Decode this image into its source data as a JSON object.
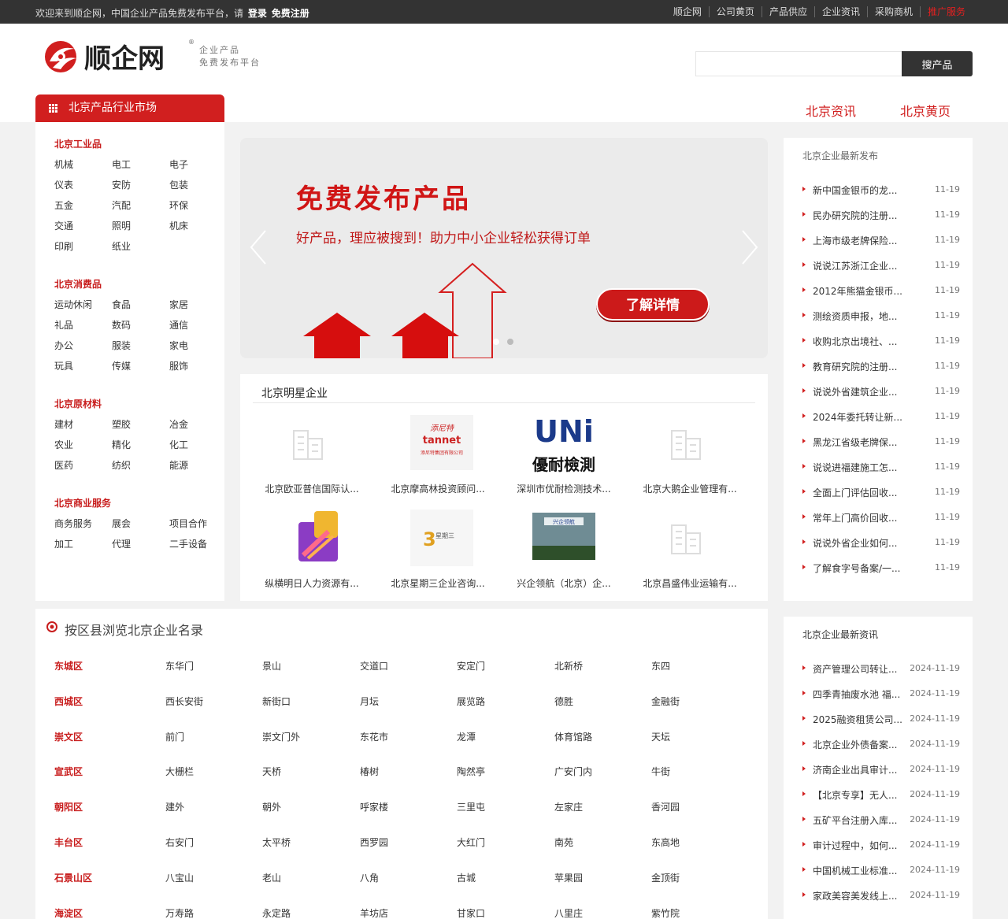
{
  "topbar": {
    "welcome": "欢迎来到顺企网，中国企业产品免费发布平台，请",
    "login": "登录",
    "register": "免费注册",
    "nav": [
      "顺企网",
      "公司黄页",
      "产品供应",
      "企业资讯",
      "采购商机",
      "推广服务"
    ]
  },
  "header": {
    "logo_text": "顺企网",
    "slogan_1": "企业产品",
    "slogan_2": "免费发布平台",
    "search_placeholder": "",
    "search_button": "搜产品"
  },
  "category": {
    "title": "北京产品行业市场",
    "tabs": [
      "北京资讯",
      "北京黄页"
    ],
    "groups": [
      {
        "title": "北京工业品",
        "items": [
          "机械",
          "电工",
          "电子",
          "仪表",
          "安防",
          "包装",
          "五金",
          "汽配",
          "环保",
          "交通",
          "照明",
          "机床",
          "印刷",
          "纸业"
        ]
      },
      {
        "title": "北京消费品",
        "items": [
          "运动休闲",
          "食品",
          "家居",
          "礼品",
          "数码",
          "通信",
          "办公",
          "服装",
          "家电",
          "玩具",
          "传媒",
          "服饰"
        ]
      },
      {
        "title": "北京原材料",
        "items": [
          "建材",
          "塑胶",
          "冶金",
          "农业",
          "精化",
          "化工",
          "医药",
          "纺织",
          "能源"
        ]
      },
      {
        "title": "北京商业服务",
        "items": [
          "商务服务",
          "展会",
          "项目合作",
          "加工",
          "代理",
          "二手设备"
        ]
      }
    ]
  },
  "banner": {
    "headline": "免费发布产品",
    "subline": "好产品，理应被搜到！助力中小企业轻松获得订单",
    "button": "了解详情"
  },
  "star": {
    "title": "北京明星企业",
    "companies": [
      {
        "name": "北京欧亚普信国际认...",
        "logo": "placeholder"
      },
      {
        "name": "北京摩高林投资顾问...",
        "logo": "tannet",
        "logo_text_1": "添尼特",
        "logo_text_2": "tannet",
        "logo_text_3": "添尼特集团有限公司"
      },
      {
        "name": "深圳市优耐检测技术...",
        "logo": "uni",
        "logo_text_1": "UNi",
        "logo_text_2": "優耐檢測"
      },
      {
        "name": "北京大鹅企业管理有...",
        "logo": "placeholder"
      },
      {
        "name": "纵横明日人力资源有...",
        "logo": "hr"
      },
      {
        "name": "北京星期三企业咨询...",
        "logo": "wed",
        "logo_text_1": "3",
        "logo_text_2": "星期三"
      },
      {
        "name": "兴企领航（北京）企...",
        "logo": "photo",
        "logo_text_1": "兴企领航"
      },
      {
        "name": "北京昌盛伟业运输有...",
        "logo": "placeholder"
      }
    ]
  },
  "latest": {
    "title": "北京企业最新发布",
    "items": [
      {
        "t": "新中国金银币的龙...",
        "d": "11-19"
      },
      {
        "t": "民办研究院的注册...",
        "d": "11-19"
      },
      {
        "t": "上海市级老牌保险...",
        "d": "11-19"
      },
      {
        "t": "说说江苏浙江企业...",
        "d": "11-19"
      },
      {
        "t": "2012年熊猫金银币...",
        "d": "11-19"
      },
      {
        "t": "测绘资质申报，地...",
        "d": "11-19"
      },
      {
        "t": "收购北京出境社、...",
        "d": "11-19"
      },
      {
        "t": "教育研究院的注册...",
        "d": "11-19"
      },
      {
        "t": "说说外省建筑企业...",
        "d": "11-19"
      },
      {
        "t": "2024年委托转让新...",
        "d": "11-19"
      },
      {
        "t": "黑龙江省级老牌保...",
        "d": "11-19"
      },
      {
        "t": "说说进福建施工怎...",
        "d": "11-19"
      },
      {
        "t": "全面上门评估回收...",
        "d": "11-19"
      },
      {
        "t": "常年上门高价回收...",
        "d": "11-19"
      },
      {
        "t": "说说外省企业如何...",
        "d": "11-19"
      },
      {
        "t": "了解食字号备案/一...",
        "d": "11-19"
      }
    ]
  },
  "news": {
    "title": "北京企业最新资讯",
    "items": [
      {
        "t": "资产管理公司转让...",
        "d": "2024-11-19"
      },
      {
        "t": "四季青抽废水池 福...",
        "d": "2024-11-19"
      },
      {
        "t": "2025融资租赁公司...",
        "d": "2024-11-19"
      },
      {
        "t": "北京企业外债备案...",
        "d": "2024-11-19"
      },
      {
        "t": "济南企业出具审计...",
        "d": "2024-11-19"
      },
      {
        "t": "【北京专享】无人...",
        "d": "2024-11-19"
      },
      {
        "t": "五矿平台注册入库...",
        "d": "2024-11-19"
      },
      {
        "t": "审计过程中，如何...",
        "d": "2024-11-19"
      },
      {
        "t": "中国机械工业标准...",
        "d": "2024-11-19"
      },
      {
        "t": "家政美容美发线上...",
        "d": "2024-11-19"
      }
    ]
  },
  "areas": {
    "title": "按区县浏览北京企业名录",
    "rows": [
      {
        "district": "东城区",
        "places": [
          "东华门",
          "景山",
          "交道口",
          "安定门",
          "北新桥",
          "东四"
        ]
      },
      {
        "district": "西城区",
        "places": [
          "西长安街",
          "新街口",
          "月坛",
          "展览路",
          "德胜",
          "金融街"
        ]
      },
      {
        "district": "崇文区",
        "places": [
          "前门",
          "崇文门外",
          "东花市",
          "龙潭",
          "体育馆路",
          "天坛"
        ]
      },
      {
        "district": "宣武区",
        "places": [
          "大栅栏",
          "天桥",
          "椿树",
          "陶然亭",
          "广安门内",
          "牛街"
        ]
      },
      {
        "district": "朝阳区",
        "places": [
          "建外",
          "朝外",
          "呼家楼",
          "三里屯",
          "左家庄",
          "香河园"
        ]
      },
      {
        "district": "丰台区",
        "places": [
          "右安门",
          "太平桥",
          "西罗园",
          "大红门",
          "南苑",
          "东高地"
        ]
      },
      {
        "district": "石景山区",
        "places": [
          "八宝山",
          "老山",
          "八角",
          "古城",
          "苹果园",
          "金顶街"
        ]
      },
      {
        "district": "海淀区",
        "places": [
          "万寿路",
          "永定路",
          "羊坊店",
          "甘家口",
          "八里庄",
          "紫竹院"
        ]
      }
    ]
  },
  "colors": {
    "brand_red": "#d11f1f",
    "topbar": "#333333",
    "background": "#f2f2f2"
  }
}
